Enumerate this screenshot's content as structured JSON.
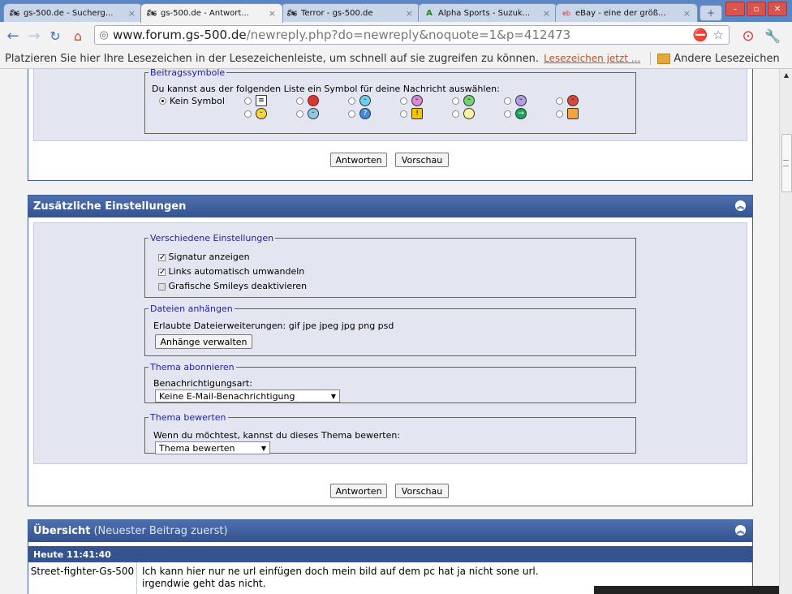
{
  "tabs": [
    {
      "title": "gs-500.de - Sucherg...",
      "icon": "bike-icon",
      "active": false
    },
    {
      "title": "gs-500.de - Antwort...",
      "icon": "bike-icon",
      "active": true
    },
    {
      "title": "Terror - gs-500.de",
      "icon": "bike-icon",
      "active": false
    },
    {
      "title": "Alpha Sports - Suzuk...",
      "icon": "alpha-logo-icon",
      "active": false
    },
    {
      "title": "eBay - eine der größ...",
      "icon": "ebay-icon",
      "active": false
    }
  ],
  "address": {
    "host": "www.forum.gs-500.de",
    "path": "/newreply.php?do=newreply&noquote=1&p=412473"
  },
  "bookmarks": {
    "hint": "Platzieren Sie hier Ihre Lesezeichen in der Lesezeichenleiste, um schnell auf sie zugreifen zu können.",
    "link": "Lesezeichen jetzt ...",
    "other": "Andere Lesezeichen"
  },
  "symbols": {
    "legend": "Beitragssymbole",
    "intro": "Du kannst aus der folgenden Liste ein Symbol für deine Nachricht auswählen:",
    "none_label": "Kein Symbol"
  },
  "buttons": {
    "reply": "Antworten",
    "preview": "Vorschau",
    "attachments": "Anhänge verwalten"
  },
  "extra": {
    "title": "Zusätzliche Einstellungen",
    "misc_legend": "Verschiedene Einstellungen",
    "signature": "Signatur anzeigen",
    "links": "Links automatisch umwandeln",
    "smileys": "Grafische Smileys deaktivieren",
    "attach_legend": "Dateien anhängen",
    "allowed": "Erlaubte Dateierweiterungen: gif jpe jpeg jpg png psd",
    "subscribe_legend": "Thema abonnieren",
    "notify_label": "Benachrichtigungsart:",
    "notify_value": "Keine E-Mail-Benachrichtigung",
    "rate_legend": "Thema bewerten",
    "rate_label": "Wenn du möchtest, kannst du dieses Thema bewerten:",
    "rate_value": "Thema bewerten"
  },
  "overview": {
    "title": "Übersicht",
    "subtitle": "(Neuester Beitrag zuerst)",
    "date": "Heute 11:41:40",
    "user": "Street-fighter-Gs-500",
    "line1": "Ich kann hier nur ne url einfügen doch mein bild auf dem pc hat ja nicht sone url.",
    "line2": "irgendwie geht das nicht."
  }
}
